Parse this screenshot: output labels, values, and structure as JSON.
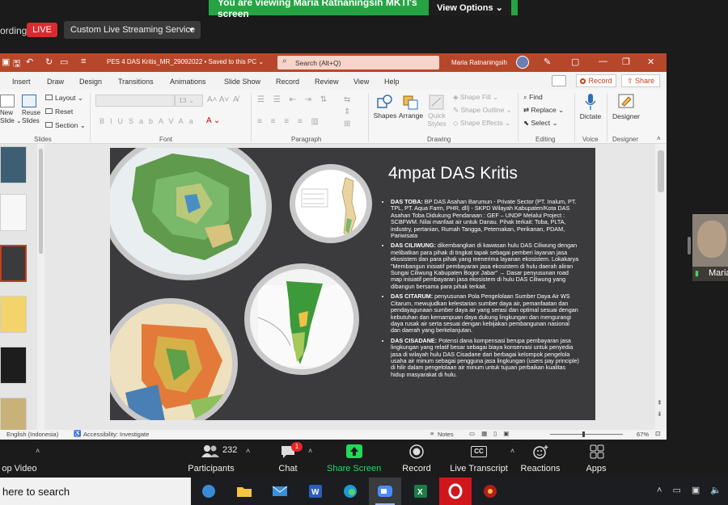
{
  "zoom": {
    "viewing_text": "You are viewing Maria Ratnaningsih MKTI's screen",
    "view_options": "View Options",
    "recording_text": "ording",
    "live_label": "LIVE",
    "stream_service": "Custom Live Streaming Service",
    "participant_name": "Maria",
    "toolbar": {
      "stop_video": "op Video",
      "participants_label": "Participants",
      "participants_count": "232",
      "chat_label": "Chat",
      "chat_badge": "1",
      "share_label": "Share Screen",
      "record_label": "Record",
      "transcript_label": "Live Transcript",
      "transcript_icon_text": "CC",
      "reactions_label": "Reactions",
      "apps_label": "Apps"
    }
  },
  "ppt": {
    "doc_title": "PES 4 DAS Kritis_MR_29092022 • Saved to this PC ⌄",
    "search_placeholder": "Search (Alt+Q)",
    "user_name": "Maria Ratnaningsih",
    "menu": [
      "Insert",
      "Draw",
      "Design",
      "Transitions",
      "Animations",
      "Slide Show",
      "Record",
      "Review",
      "View",
      "Help"
    ],
    "record_button": "Record",
    "share_button": "Share",
    "ribbon": {
      "layout": "Layout ⌄",
      "reset": "Reset",
      "section": "Section ⌄",
      "new_slide": "New\nSlide ⌄",
      "reuse_slides": "Reuse\nSlides",
      "slides_group": "Slides",
      "font_group": "Font",
      "paragraph_group": "Paragraph",
      "drawing_group": "Drawing",
      "editing_group": "Editing",
      "voice_group": "Voice",
      "designer_group": "Designer",
      "font_size": "13",
      "shapes": "Shapes",
      "arrange": "Arrange",
      "quick_styles": "Quick\nStyles",
      "shape_fill": "Shape Fill ⌄",
      "shape_outline": "Shape Outline ⌄",
      "shape_effects": "Shape Effects ⌄",
      "find": "Find",
      "replace": "Replace ⌄",
      "select": "Select ⌄",
      "dictate": "Dictate",
      "designer": "Designer"
    },
    "status": {
      "language": "English (Indonesia)",
      "accessibility": "Accessibility: Investigate",
      "notes": "Notes",
      "zoom": "67%"
    }
  },
  "slide": {
    "title": "4mpat DAS Kritis",
    "bullets": [
      {
        "head": "DAS TOBA:",
        "body": " BP DAS Asahan Barumun - Private Sector (PT. Inalum, PT. TPL, PT. Aqua Farm, PHR, dll) - SKPD Wilayah Kabupaten/Kota DAS Asahan Toba Didukung Pendanaan : GEF – UNDP Melalui Project : SCBFWM. Nilai manfaat air untuk Danau. Pihak terkait: Toba, PLTA, industry, pertanian, Rumah Tangga, Peternakan, Perikanan, PDAM, Pariwisata"
      },
      {
        "head": "DAS CILIWUNG:",
        "body": " dikembangkan di kawasan hulu DAS Ciliwung dengan melibatkan para pihak di tingkat tapak sebagai pemberi layanan jasa ekosistem dan para pihak yang menerima layanan ekosistem. Lokakarya \"Membangun inisiatif pembayaran jasa ekosistem di hulu daerah aliran Sungai Ciliwung Kabupaten Bogor Jabar\" → Dasar penyusunan road map inisiatif pembayaran jasa ekosistem di hulu DAS Ciliwung yang dibangun bersama para pihak terkait."
      },
      {
        "head": "DAS CITARUM:",
        "body": " penyusunan Pola Pengelolaan Sumber Daya Air WS Citarum, mewujudkan kelestarian sumber daya air, pemanfaatan dan pendayagunaan sumber daya air yang serasi dan optimal sesuai dengan kebutuhan dan kemampuan daya dukung lingkungan dan mengurangi daya rusak air serta sesuai dengan kebijakan pembangunan nasional dan daerah yang berkelanjutan."
      },
      {
        "head": "DAS CISADANE:",
        "body": " Potensi dana kompensasi berupa pembayaran jasa lingkungan yang relatif besar sebagai biaya konservasi untuk penyedia jasa di wilayah hulu DAS Cisadane dari berbagai kelompok pengelola usaha air minum sebagai pengguna jasa lingkungan (users pay principle) di hilir dalam pengelolaan air minum untuk tujuan perbaikan kualitas hidup masyarakat di hulu."
      }
    ]
  },
  "taskbar": {
    "search_text": "here to search"
  },
  "colors": {
    "ppt_accent": "#b7472a",
    "zoom_green": "#26a443",
    "live_red": "#d92b2f"
  }
}
